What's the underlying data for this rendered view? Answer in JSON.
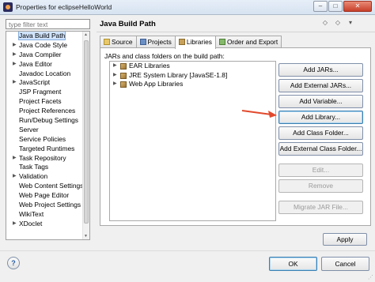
{
  "window": {
    "title": "Properties for eclipseHelloWorld",
    "minimize_label": "–",
    "maximize_label": "□",
    "close_label": "✕"
  },
  "filter": {
    "placeholder": "type filter text"
  },
  "tree": {
    "items": [
      {
        "label": "Java Build Path",
        "expandable": false,
        "selected": true
      },
      {
        "label": "Java Code Style",
        "expandable": true
      },
      {
        "label": "Java Compiler",
        "expandable": true
      },
      {
        "label": "Java Editor",
        "expandable": true
      },
      {
        "label": "Javadoc Location",
        "expandable": false
      },
      {
        "label": "JavaScript",
        "expandable": true
      },
      {
        "label": "JSP Fragment",
        "expandable": false
      },
      {
        "label": "Project Facets",
        "expandable": false
      },
      {
        "label": "Project References",
        "expandable": false
      },
      {
        "label": "Run/Debug Settings",
        "expandable": false
      },
      {
        "label": "Server",
        "expandable": false
      },
      {
        "label": "Service Policies",
        "expandable": false
      },
      {
        "label": "Targeted Runtimes",
        "expandable": false
      },
      {
        "label": "Task Repository",
        "expandable": true
      },
      {
        "label": "Task Tags",
        "expandable": false
      },
      {
        "label": "Validation",
        "expandable": true
      },
      {
        "label": "Web Content Settings",
        "expandable": false
      },
      {
        "label": "Web Page Editor",
        "expandable": false
      },
      {
        "label": "Web Project Settings",
        "expandable": false
      },
      {
        "label": "WikiText",
        "expandable": false
      },
      {
        "label": "XDoclet",
        "expandable": true
      }
    ]
  },
  "page": {
    "title": "Java Build Path",
    "back_icon": "◇",
    "fwd_icon": "◇",
    "menu_icon": "▾"
  },
  "tabs": [
    {
      "label": "Source",
      "icon": "source-folder-icon",
      "active": false
    },
    {
      "label": "Projects",
      "icon": "projects-icon",
      "active": false
    },
    {
      "label": "Libraries",
      "icon": "libraries-icon",
      "active": true
    },
    {
      "label": "Order and Export",
      "icon": "order-export-icon",
      "active": false
    }
  ],
  "libraries": {
    "caption": "JARs and class folders on the build path:",
    "items": [
      {
        "label": "EAR Libraries"
      },
      {
        "label": "JRE System Library [JavaSE-1.8]"
      },
      {
        "label": "Web App Libraries"
      }
    ]
  },
  "buttons": {
    "add_jars": "Add JARs...",
    "add_external_jars": "Add External JARs...",
    "add_variable": "Add Variable...",
    "add_library": "Add Library...",
    "add_class_folder": "Add Class Folder...",
    "add_external_class_folder": "Add External Class Folder...",
    "edit": "Edit...",
    "remove": "Remove",
    "migrate_jar": "Migrate JAR File...",
    "apply": "Apply",
    "ok": "OK",
    "cancel": "Cancel",
    "help": "?"
  },
  "colors": {
    "annotation_arrow": "#e2492c",
    "selection": "#cfe3fb"
  }
}
